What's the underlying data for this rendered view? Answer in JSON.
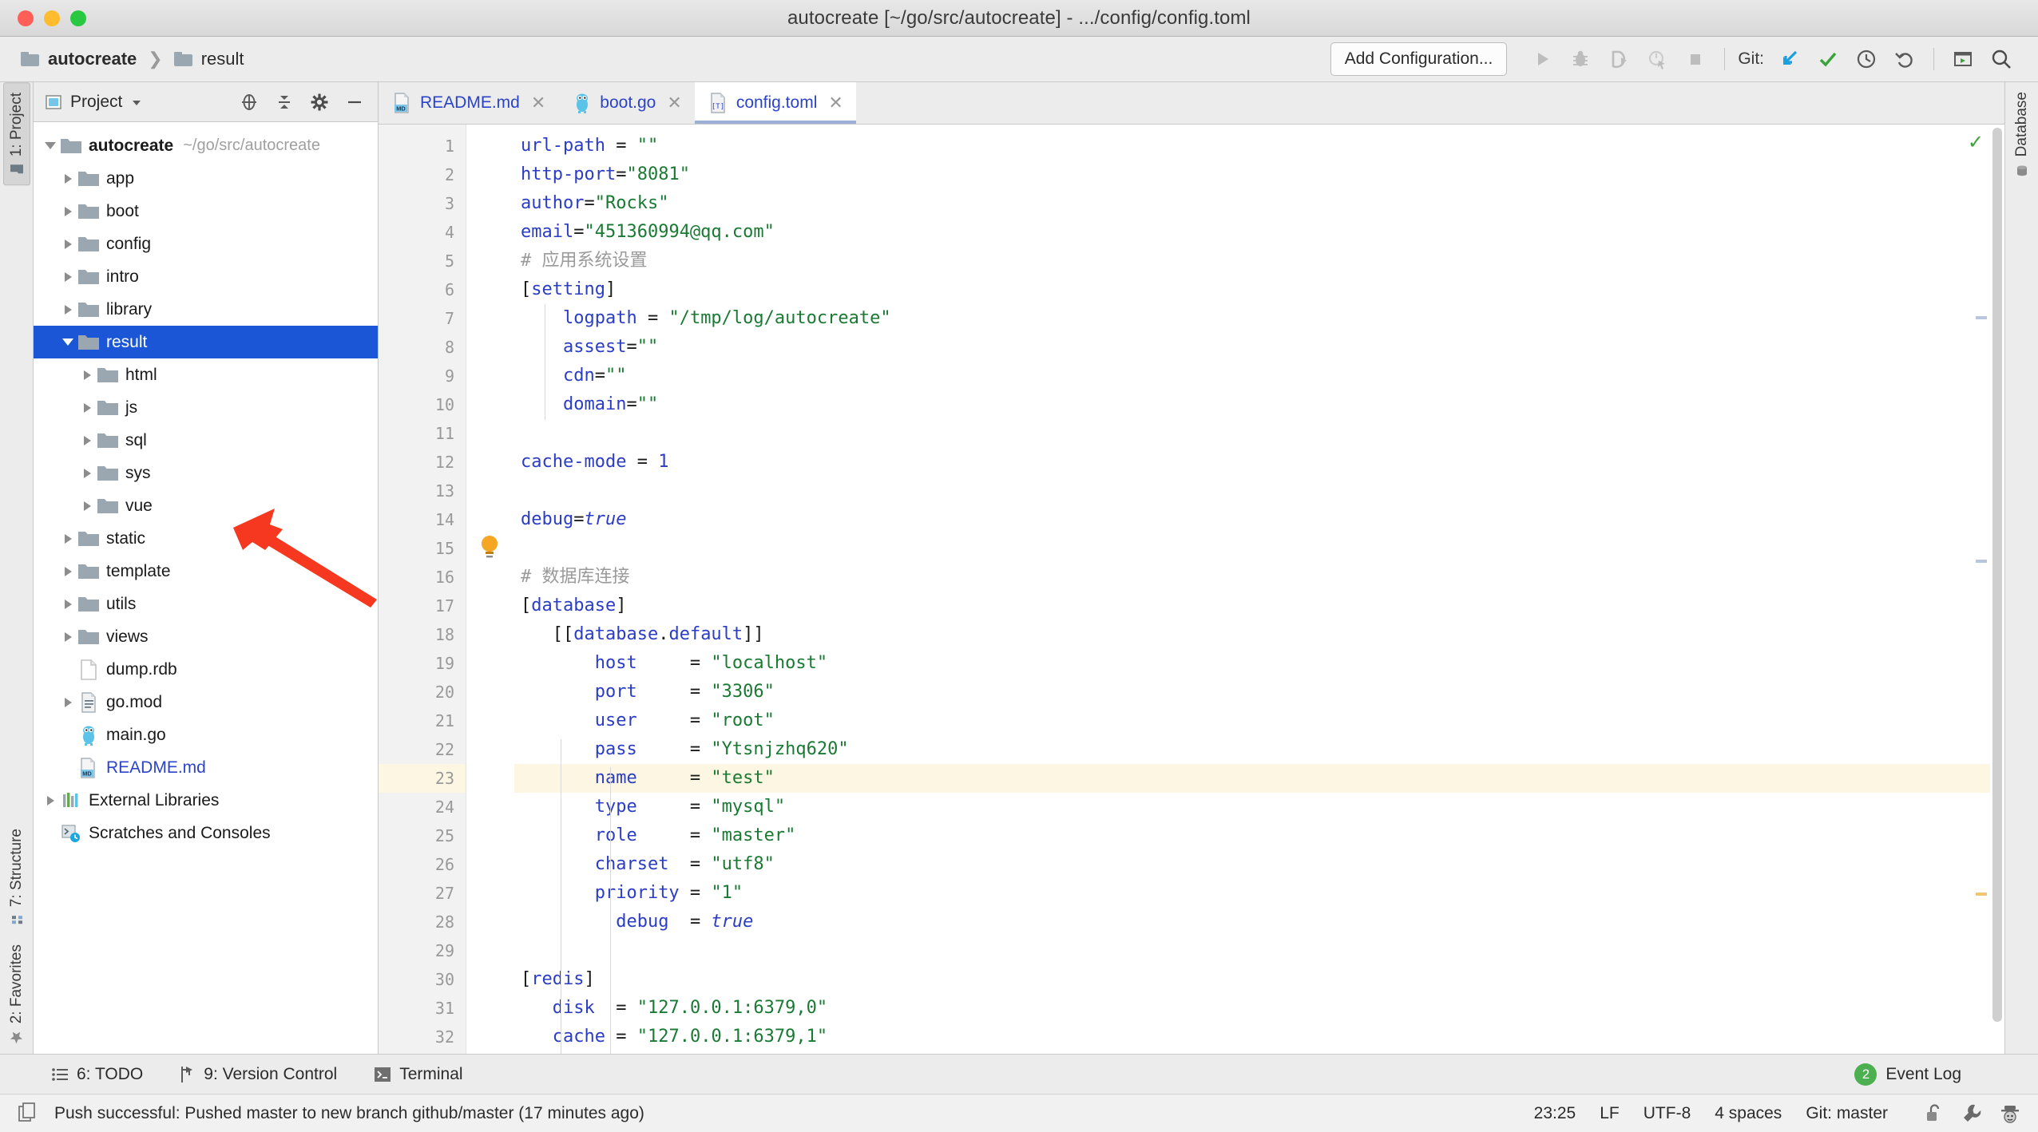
{
  "window": {
    "title": "autocreate [~/go/src/autocreate] - .../config/config.toml",
    "traffic_lights": [
      "close",
      "minimize",
      "zoom"
    ]
  },
  "toolbar": {
    "breadcrumb": [
      {
        "label": "autocreate",
        "icon": "folder-icon",
        "bold": true
      },
      {
        "label": "result",
        "icon": "folder-icon",
        "bold": false
      }
    ],
    "breadcrumb_separator": "❯",
    "add_configuration_label": "Add Configuration...",
    "run_icons": [
      "run-icon",
      "debug-icon",
      "run-with-coverage-icon",
      "profile-icon",
      "stop-icon"
    ],
    "git_label": "Git:",
    "git_icons": [
      "update-project-icon",
      "commit-icon",
      "history-icon",
      "rollback-icon"
    ],
    "right_icons": [
      "terminal-icon",
      "search-everywhere-icon"
    ]
  },
  "left_strip": {
    "tabs": [
      {
        "label": "1: Project",
        "icon": "project-folder-icon",
        "active": true
      },
      {
        "label": "7: Structure",
        "icon": "structure-icon",
        "active": false
      },
      {
        "label": "2: Favorites",
        "icon": "star-icon",
        "active": false
      }
    ]
  },
  "right_strip": {
    "tabs": [
      {
        "label": "Database",
        "icon": "database-icon",
        "active": false
      }
    ]
  },
  "project_panel": {
    "title": "Project",
    "dropdown_icon": "chevron-down-icon",
    "header_icons": [
      "locate-icon",
      "collapse-all-icon",
      "settings-gear-icon",
      "hide-icon"
    ],
    "tree": [
      {
        "label": "autocreate",
        "path": "~/go/src/autocreate",
        "icon": "folder-icon",
        "indent": 0,
        "state": "open",
        "bold": true,
        "selected": false
      },
      {
        "label": "app",
        "icon": "folder-icon",
        "indent": 1,
        "state": "closed",
        "selected": false
      },
      {
        "label": "boot",
        "icon": "folder-icon",
        "indent": 1,
        "state": "closed",
        "selected": false
      },
      {
        "label": "config",
        "icon": "folder-icon",
        "indent": 1,
        "state": "closed",
        "selected": false
      },
      {
        "label": "intro",
        "icon": "folder-icon",
        "indent": 1,
        "state": "closed",
        "selected": false
      },
      {
        "label": "library",
        "icon": "folder-icon",
        "indent": 1,
        "state": "closed",
        "selected": false
      },
      {
        "label": "result",
        "icon": "folder-icon",
        "indent": 1,
        "state": "open",
        "selected": true
      },
      {
        "label": "html",
        "icon": "folder-icon",
        "indent": 2,
        "state": "closed",
        "selected": false
      },
      {
        "label": "js",
        "icon": "folder-icon",
        "indent": 2,
        "state": "closed",
        "selected": false
      },
      {
        "label": "sql",
        "icon": "folder-icon",
        "indent": 2,
        "state": "closed",
        "selected": false
      },
      {
        "label": "sys",
        "icon": "folder-icon",
        "indent": 2,
        "state": "closed",
        "selected": false
      },
      {
        "label": "vue",
        "icon": "folder-icon",
        "indent": 2,
        "state": "closed",
        "selected": false
      },
      {
        "label": "static",
        "icon": "folder-icon",
        "indent": 1,
        "state": "closed",
        "selected": false
      },
      {
        "label": "template",
        "icon": "folder-icon",
        "indent": 1,
        "state": "closed",
        "selected": false
      },
      {
        "label": "utils",
        "icon": "folder-icon",
        "indent": 1,
        "state": "closed",
        "selected": false
      },
      {
        "label": "views",
        "icon": "folder-icon",
        "indent": 1,
        "state": "closed",
        "selected": false
      },
      {
        "label": "dump.rdb",
        "icon": "file-icon",
        "indent": 1,
        "state": "none",
        "selected": false
      },
      {
        "label": "go.mod",
        "icon": "gomod-icon",
        "indent": 1,
        "state": "closed",
        "selected": false
      },
      {
        "label": "main.go",
        "icon": "go-gopher-icon",
        "indent": 1,
        "state": "none",
        "selected": false
      },
      {
        "label": "README.md",
        "icon": "markdown-icon",
        "indent": 1,
        "state": "none",
        "selected": false,
        "link": true
      },
      {
        "label": "External Libraries",
        "icon": "libraries-icon",
        "indent": 0,
        "state": "closed",
        "selected": false
      },
      {
        "label": "Scratches and Consoles",
        "icon": "scratches-icon",
        "indent": 0,
        "state": "none",
        "selected": false
      }
    ]
  },
  "editor": {
    "tabs": [
      {
        "label": "README.md",
        "icon": "markdown-icon",
        "active": false,
        "close_icon": "close-icon"
      },
      {
        "label": "boot.go",
        "icon": "go-gopher-icon",
        "active": false,
        "close_icon": "close-icon"
      },
      {
        "label": "config.toml",
        "icon": "toml-icon",
        "active": true,
        "close_icon": "close-icon"
      }
    ],
    "filename": "config.toml",
    "highlighted_line": 23,
    "gutter_icon_line_23": "intention-bulb-icon",
    "inspection_status": "ok",
    "lines": [
      {
        "n": 1,
        "tokens": [
          {
            "t": "url-path",
            "c": "k"
          },
          {
            "t": " = ",
            "c": "p"
          },
          {
            "t": "\"\"",
            "c": "s"
          }
        ]
      },
      {
        "n": 2,
        "tokens": [
          {
            "t": "http-port",
            "c": "k"
          },
          {
            "t": "=",
            "c": "p"
          },
          {
            "t": "\"8081\"",
            "c": "s"
          }
        ]
      },
      {
        "n": 3,
        "tokens": [
          {
            "t": "author",
            "c": "k"
          },
          {
            "t": "=",
            "c": "p"
          },
          {
            "t": "\"Rocks\"",
            "c": "s"
          }
        ]
      },
      {
        "n": 4,
        "tokens": [
          {
            "t": "email",
            "c": "k"
          },
          {
            "t": "=",
            "c": "p"
          },
          {
            "t": "\"451360994@qq.com\"",
            "c": "s"
          }
        ]
      },
      {
        "n": 5,
        "tokens": [
          {
            "t": "# 应用系统设置",
            "c": "c"
          }
        ]
      },
      {
        "n": 6,
        "tokens": [
          {
            "t": "[",
            "c": "p"
          },
          {
            "t": "setting",
            "c": "k"
          },
          {
            "t": "]",
            "c": "p"
          }
        ]
      },
      {
        "n": 7,
        "tokens": [
          {
            "t": "    ",
            "c": "p"
          },
          {
            "t": "logpath",
            "c": "k"
          },
          {
            "t": " = ",
            "c": "p"
          },
          {
            "t": "\"/tmp/log/autocreate\"",
            "c": "s"
          }
        ]
      },
      {
        "n": 8,
        "tokens": [
          {
            "t": "    ",
            "c": "p"
          },
          {
            "t": "assest",
            "c": "k"
          },
          {
            "t": "=",
            "c": "p"
          },
          {
            "t": "\"\"",
            "c": "s"
          }
        ]
      },
      {
        "n": 9,
        "tokens": [
          {
            "t": "    ",
            "c": "p"
          },
          {
            "t": "cdn",
            "c": "k"
          },
          {
            "t": "=",
            "c": "p"
          },
          {
            "t": "\"\"",
            "c": "s"
          }
        ]
      },
      {
        "n": 10,
        "tokens": [
          {
            "t": "    ",
            "c": "p"
          },
          {
            "t": "domain",
            "c": "k"
          },
          {
            "t": "=",
            "c": "p"
          },
          {
            "t": "\"\"",
            "c": "s"
          }
        ]
      },
      {
        "n": 11,
        "tokens": []
      },
      {
        "n": 12,
        "tokens": [
          {
            "t": "cache-mode",
            "c": "k"
          },
          {
            "t": " = ",
            "c": "p"
          },
          {
            "t": "1",
            "c": "n"
          }
        ]
      },
      {
        "n": 13,
        "tokens": []
      },
      {
        "n": 14,
        "tokens": [
          {
            "t": "debug",
            "c": "k"
          },
          {
            "t": "=",
            "c": "p"
          },
          {
            "t": "true",
            "c": "b"
          }
        ]
      },
      {
        "n": 15,
        "tokens": []
      },
      {
        "n": 16,
        "tokens": [
          {
            "t": "# 数据库连接",
            "c": "c"
          }
        ]
      },
      {
        "n": 17,
        "tokens": [
          {
            "t": "[",
            "c": "p"
          },
          {
            "t": "database",
            "c": "k"
          },
          {
            "t": "]",
            "c": "p"
          }
        ]
      },
      {
        "n": 18,
        "tokens": [
          {
            "t": "   [[",
            "c": "p"
          },
          {
            "t": "database",
            "c": "k"
          },
          {
            "t": ".",
            "c": "p"
          },
          {
            "t": "default",
            "c": "k"
          },
          {
            "t": "]]",
            "c": "p"
          }
        ]
      },
      {
        "n": 19,
        "tokens": [
          {
            "t": "       ",
            "c": "p"
          },
          {
            "t": "host",
            "c": "k"
          },
          {
            "t": "     = ",
            "c": "p"
          },
          {
            "t": "\"localhost\"",
            "c": "s"
          }
        ]
      },
      {
        "n": 20,
        "tokens": [
          {
            "t": "       ",
            "c": "p"
          },
          {
            "t": "port",
            "c": "k"
          },
          {
            "t": "     = ",
            "c": "p"
          },
          {
            "t": "\"3306\"",
            "c": "s"
          }
        ]
      },
      {
        "n": 21,
        "tokens": [
          {
            "t": "       ",
            "c": "p"
          },
          {
            "t": "user",
            "c": "k"
          },
          {
            "t": "     = ",
            "c": "p"
          },
          {
            "t": "\"root\"",
            "c": "s"
          }
        ]
      },
      {
        "n": 22,
        "tokens": [
          {
            "t": "       ",
            "c": "p"
          },
          {
            "t": "pass",
            "c": "k"
          },
          {
            "t": "     = ",
            "c": "p"
          },
          {
            "t": "\"Ytsnjzhq620\"",
            "c": "s"
          }
        ]
      },
      {
        "n": 23,
        "tokens": [
          {
            "t": "       ",
            "c": "p"
          },
          {
            "t": "name",
            "c": "k"
          },
          {
            "t": "     = ",
            "c": "p"
          },
          {
            "t": "\"test\"",
            "c": "s"
          }
        ],
        "highlight": true
      },
      {
        "n": 24,
        "tokens": [
          {
            "t": "       ",
            "c": "p"
          },
          {
            "t": "type",
            "c": "k"
          },
          {
            "t": "     = ",
            "c": "p"
          },
          {
            "t": "\"mysql\"",
            "c": "s"
          }
        ]
      },
      {
        "n": 25,
        "tokens": [
          {
            "t": "       ",
            "c": "p"
          },
          {
            "t": "role",
            "c": "k"
          },
          {
            "t": "     = ",
            "c": "p"
          },
          {
            "t": "\"master\"",
            "c": "s"
          }
        ]
      },
      {
        "n": 26,
        "tokens": [
          {
            "t": "       ",
            "c": "p"
          },
          {
            "t": "charset",
            "c": "k"
          },
          {
            "t": "  = ",
            "c": "p"
          },
          {
            "t": "\"utf8\"",
            "c": "s"
          }
        ]
      },
      {
        "n": 27,
        "tokens": [
          {
            "t": "       ",
            "c": "p"
          },
          {
            "t": "priority",
            "c": "k"
          },
          {
            "t": " = ",
            "c": "p"
          },
          {
            "t": "\"1\"",
            "c": "s"
          }
        ]
      },
      {
        "n": 28,
        "tokens": [
          {
            "t": "         ",
            "c": "p"
          },
          {
            "t": "debug",
            "c": "k"
          },
          {
            "t": "  = ",
            "c": "p"
          },
          {
            "t": "true",
            "c": "b"
          }
        ]
      },
      {
        "n": 29,
        "tokens": []
      },
      {
        "n": 30,
        "tokens": [
          {
            "t": "[",
            "c": "p"
          },
          {
            "t": "redis",
            "c": "k"
          },
          {
            "t": "]",
            "c": "p"
          }
        ]
      },
      {
        "n": 31,
        "tokens": [
          {
            "t": "   ",
            "c": "p"
          },
          {
            "t": "disk",
            "c": "k"
          },
          {
            "t": "  = ",
            "c": "p"
          },
          {
            "t": "\"127.0.0.1:6379,0\"",
            "c": "s"
          }
        ]
      },
      {
        "n": 32,
        "tokens": [
          {
            "t": "   ",
            "c": "p"
          },
          {
            "t": "cache",
            "c": "k"
          },
          {
            "t": " = ",
            "c": "p"
          },
          {
            "t": "\"127.0.0.1:6379,1\"",
            "c": "s"
          }
        ]
      }
    ]
  },
  "tool_window_bar": {
    "items": [
      {
        "label": "6: TODO",
        "underline": "6",
        "icon": "todo-icon"
      },
      {
        "label": "9: Version Control",
        "underline": "9",
        "icon": "version-control-icon"
      },
      {
        "label": "Terminal",
        "underline": "",
        "icon": "terminal-icon"
      }
    ],
    "event_log_label": "Event Log",
    "event_log_count": "2"
  },
  "status_bar": {
    "message": "Push successful: Pushed master to new branch github/master (17 minutes ago)",
    "message_icon": "copy-icon",
    "caret_position": "23:25",
    "line_separator": "LF",
    "encoding": "UTF-8",
    "indent": "4 spaces",
    "branch": "Git: master",
    "icons": [
      "unlock-icon",
      "wrench-icon",
      "hector-icon"
    ]
  },
  "annotation": {
    "type": "arrow",
    "color": "#f5381f",
    "points_to": "js"
  },
  "colors": {
    "selection_blue": "#1a56d6",
    "link_blue": "#2b44c7",
    "string_green": "#1a7a33",
    "comment_gray": "#9a9a9a",
    "highlight_row": "#fdf6e3",
    "accent_green": "#4caf50"
  }
}
